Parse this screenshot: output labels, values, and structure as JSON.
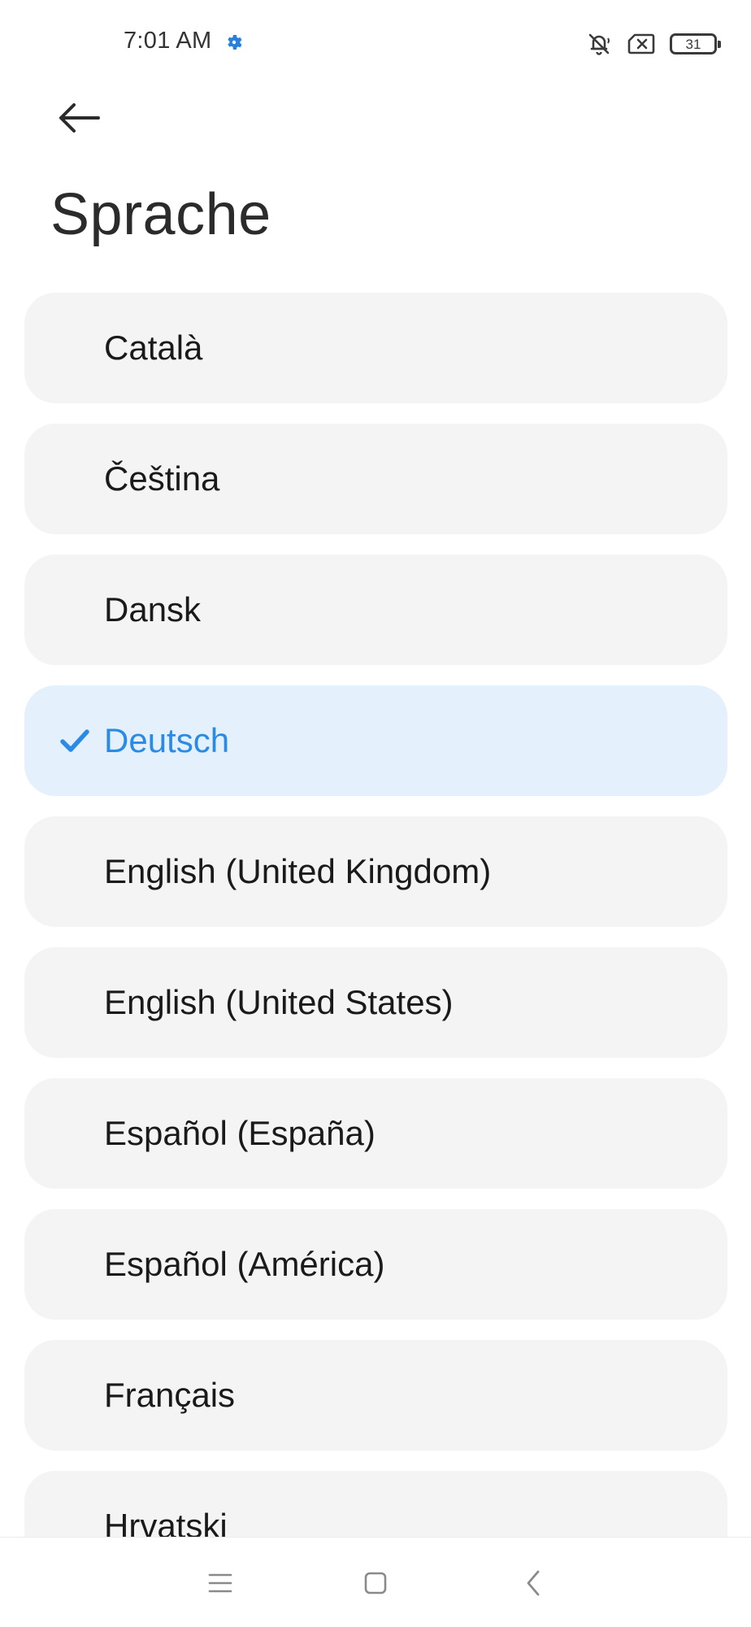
{
  "status_bar": {
    "time": "7:01 AM",
    "battery_level": "31",
    "icons": [
      "settings-gear-icon",
      "bell-muted-icon",
      "sim-error-icon",
      "battery-icon"
    ],
    "gear_color": "#2a7fdc"
  },
  "header": {
    "title": "Sprache",
    "back_icon": "arrow-left-icon"
  },
  "languages": [
    {
      "label": "Català",
      "selected": false
    },
    {
      "label": "Čeština",
      "selected": false
    },
    {
      "label": "Dansk",
      "selected": false
    },
    {
      "label": "Deutsch",
      "selected": true
    },
    {
      "label": "English (United Kingdom)",
      "selected": false
    },
    {
      "label": "English (United States)",
      "selected": false
    },
    {
      "label": "Español (España)",
      "selected": false
    },
    {
      "label": "Español (América)",
      "selected": false
    },
    {
      "label": "Français",
      "selected": false
    },
    {
      "label": "Hrvatski",
      "selected": false
    }
  ],
  "colors": {
    "accent": "#2a8be6",
    "selected_background": "#e4f0fc",
    "item_background": "#f4f4f4"
  },
  "nav_bar": {
    "icons": [
      "menu-icon",
      "home-icon",
      "back-chevron-icon"
    ]
  }
}
